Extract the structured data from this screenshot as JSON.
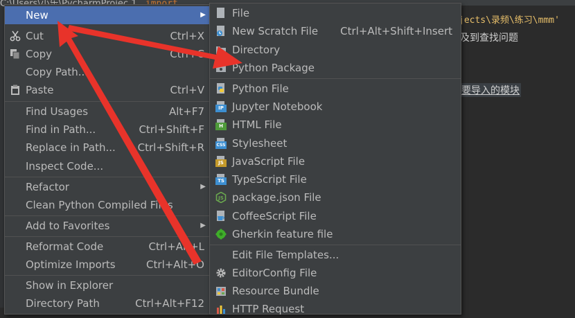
{
  "background": {
    "path_text": "C:\\Users\\小乐\\PycharmProjec",
    "path_suffix": "1",
    "code_line": "jects\\录频\\练习\\mmm'",
    "import_word": "import",
    "comment_1": "及到查找问题",
    "comment_2": "要导入的模块"
  },
  "context_menu": {
    "items": [
      {
        "label": "New",
        "shortcut": "",
        "submenu": true,
        "selected": true
      },
      {
        "label": "Cut",
        "shortcut": "Ctrl+X",
        "icon": "scissors-icon"
      },
      {
        "label": "Copy",
        "shortcut": "Ctrl+C",
        "icon": "copy-icon"
      },
      {
        "label": "Copy Path...",
        "shortcut": ""
      },
      {
        "label": "Paste",
        "shortcut": "Ctrl+V",
        "icon": "paste-icon"
      },
      {
        "label": "Find Usages",
        "shortcut": "Alt+F7"
      },
      {
        "label": "Find in Path...",
        "shortcut": "Ctrl+Shift+F"
      },
      {
        "label": "Replace in Path...",
        "shortcut": "Ctrl+Shift+R"
      },
      {
        "label": "Inspect Code...",
        "shortcut": ""
      },
      {
        "label": "Refactor",
        "shortcut": "",
        "submenu": true
      },
      {
        "label": "Clean Python Compiled Files",
        "shortcut": ""
      },
      {
        "label": "Add to Favorites",
        "shortcut": "",
        "submenu": true
      },
      {
        "label": "Reformat Code",
        "shortcut": "Ctrl+Alt+L"
      },
      {
        "label": "Optimize Imports",
        "shortcut": "Ctrl+Alt+O"
      },
      {
        "label": "Show in Explorer",
        "shortcut": ""
      },
      {
        "label": "Directory Path",
        "shortcut": "Ctrl+Alt+F12"
      }
    ]
  },
  "new_submenu": {
    "items": [
      {
        "label": "File",
        "shortcut": "",
        "icon": "file-icon"
      },
      {
        "label": "New Scratch File",
        "shortcut": "Ctrl+Alt+Shift+Insert",
        "icon": "scratch-file-icon"
      },
      {
        "label": "Directory",
        "shortcut": "",
        "icon": "folder-icon"
      },
      {
        "label": "Python Package",
        "shortcut": "",
        "icon": "package-icon"
      },
      {
        "label": "Python File",
        "shortcut": "",
        "icon": "python-file-icon"
      },
      {
        "label": "Jupyter Notebook",
        "shortcut": "",
        "icon": "jupyter-icon",
        "badge": "IP",
        "badge_color": "#3d8fd1"
      },
      {
        "label": "HTML File",
        "shortcut": "",
        "icon": "html-file-icon",
        "badge": "H",
        "badge_color": "#4e9a3a"
      },
      {
        "label": "Stylesheet",
        "shortcut": "",
        "icon": "css-file-icon",
        "badge": "CSS",
        "badge_color": "#3d8fd1"
      },
      {
        "label": "JavaScript File",
        "shortcut": "",
        "icon": "javascript-file-icon",
        "badge": "JS",
        "badge_color": "#c59a2a"
      },
      {
        "label": "TypeScript File",
        "shortcut": "",
        "icon": "typescript-file-icon",
        "badge": "TS",
        "badge_color": "#3d8fd1"
      },
      {
        "label": "package.json File",
        "shortcut": "",
        "icon": "nodejs-icon"
      },
      {
        "label": "CoffeeScript File",
        "shortcut": "",
        "icon": "coffeescript-icon"
      },
      {
        "label": "Gherkin feature file",
        "shortcut": "",
        "icon": "gherkin-icon"
      },
      {
        "label": "Edit File Templates...",
        "shortcut": ""
      },
      {
        "label": "EditorConfig File",
        "shortcut": "",
        "icon": "gear-icon"
      },
      {
        "label": "Resource Bundle",
        "shortcut": "",
        "icon": "resource-bundle-icon"
      },
      {
        "label": "HTTP Request",
        "shortcut": "",
        "icon": "http-request-icon"
      }
    ]
  },
  "colors": {
    "menu_bg": "#3c3f41",
    "selection": "#4b6eaf",
    "annotation_arrow": "#e8332a"
  }
}
